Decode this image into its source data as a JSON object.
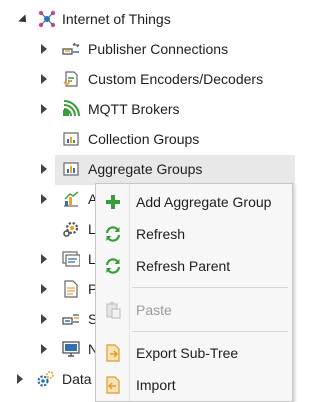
{
  "tree": {
    "root": {
      "label": "Internet of Things",
      "icon": "iot-network-icon",
      "expanded": true
    },
    "children": [
      {
        "label": "Publisher Connections",
        "icon": "publisher-connection-icon"
      },
      {
        "label": "Custom Encoders/Decoders",
        "icon": "encoder-decoder-icon"
      },
      {
        "label": "MQTT Brokers",
        "icon": "mqtt-broker-icon"
      },
      {
        "label": "Collection Groups",
        "icon": "collection-group-icon"
      },
      {
        "label": "Aggregate Groups",
        "icon": "aggregate-group-icon"
      },
      {
        "label": "A",
        "icon": "chart-icon"
      },
      {
        "label": "L",
        "icon": "gear-icon"
      },
      {
        "label": "L",
        "icon": "list-icon"
      },
      {
        "label": "P",
        "icon": "document-icon"
      },
      {
        "label": "S",
        "icon": "server-icon"
      },
      {
        "label": "N",
        "icon": "monitor-icon"
      }
    ],
    "bottom": {
      "label": "Data",
      "icon": "data-gear-icon"
    }
  },
  "context_menu": {
    "items": [
      {
        "label": "Add Aggregate Group",
        "icon": "plus-icon",
        "enabled": true
      },
      {
        "label": "Refresh",
        "icon": "refresh-icon",
        "enabled": true
      },
      {
        "label": "Refresh Parent",
        "icon": "refresh-icon",
        "enabled": true
      },
      {
        "label": "Paste",
        "icon": "paste-icon",
        "enabled": false
      },
      {
        "label": "Export Sub-Tree",
        "icon": "export-icon",
        "enabled": true
      },
      {
        "label": "Import",
        "icon": "import-icon",
        "enabled": true
      }
    ]
  },
  "colors": {
    "highlight": "#e8e8e8",
    "menu_bg": "#f7f7f7",
    "green": "#3a9b3a",
    "orange": "#f0a030",
    "blue": "#2f6fb8",
    "disabled": "#9a9a9a"
  }
}
